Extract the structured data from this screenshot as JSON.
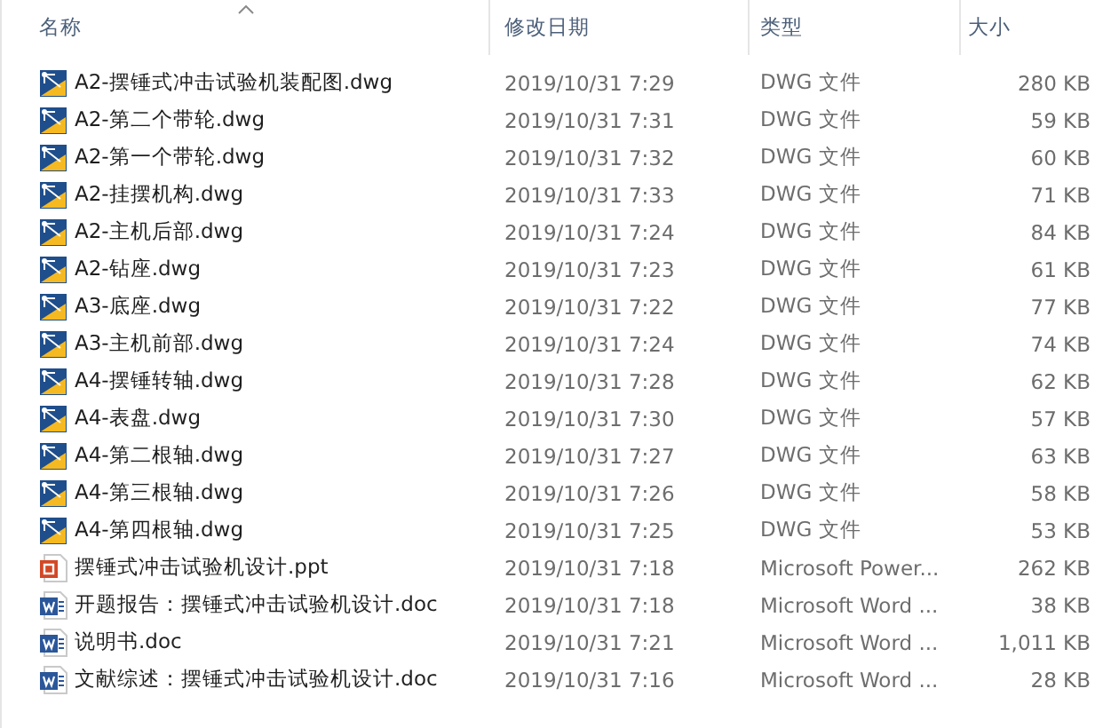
{
  "columns": [
    {
      "label": "名称",
      "sorted": true
    },
    {
      "label": "修改日期",
      "sorted": false
    },
    {
      "label": "类型",
      "sorted": false
    },
    {
      "label": "大小",
      "sorted": false
    }
  ],
  "files": [
    {
      "kind": "dwg",
      "name": "A2-摆锤式冲击试验机装配图.dwg",
      "date": "2019/10/31 7:29",
      "type": "DWG 文件",
      "size": "280 KB"
    },
    {
      "kind": "dwg",
      "name": "A2-第二个带轮.dwg",
      "date": "2019/10/31 7:31",
      "type": "DWG 文件",
      "size": "59 KB"
    },
    {
      "kind": "dwg",
      "name": "A2-第一个带轮.dwg",
      "date": "2019/10/31 7:32",
      "type": "DWG 文件",
      "size": "60 KB"
    },
    {
      "kind": "dwg",
      "name": "A2-挂摆机构.dwg",
      "date": "2019/10/31 7:33",
      "type": "DWG 文件",
      "size": "71 KB"
    },
    {
      "kind": "dwg",
      "name": "A2-主机后部.dwg",
      "date": "2019/10/31 7:24",
      "type": "DWG 文件",
      "size": "84 KB"
    },
    {
      "kind": "dwg",
      "name": "A2-钻座.dwg",
      "date": "2019/10/31 7:23",
      "type": "DWG 文件",
      "size": "61 KB"
    },
    {
      "kind": "dwg",
      "name": "A3-底座.dwg",
      "date": "2019/10/31 7:22",
      "type": "DWG 文件",
      "size": "77 KB"
    },
    {
      "kind": "dwg",
      "name": "A3-主机前部.dwg",
      "date": "2019/10/31 7:24",
      "type": "DWG 文件",
      "size": "74 KB"
    },
    {
      "kind": "dwg",
      "name": "A4-摆锤转轴.dwg",
      "date": "2019/10/31 7:28",
      "type": "DWG 文件",
      "size": "62 KB"
    },
    {
      "kind": "dwg",
      "name": "A4-表盘.dwg",
      "date": "2019/10/31 7:30",
      "type": "DWG 文件",
      "size": "57 KB"
    },
    {
      "kind": "dwg",
      "name": "A4-第二根轴.dwg",
      "date": "2019/10/31 7:27",
      "type": "DWG 文件",
      "size": "63 KB"
    },
    {
      "kind": "dwg",
      "name": "A4-第三根轴.dwg",
      "date": "2019/10/31 7:26",
      "type": "DWG 文件",
      "size": "58 KB"
    },
    {
      "kind": "dwg",
      "name": "A4-第四根轴.dwg",
      "date": "2019/10/31 7:25",
      "type": "DWG 文件",
      "size": "53 KB"
    },
    {
      "kind": "ppt",
      "name": "摆锤式冲击试验机设计.ppt",
      "date": "2019/10/31 7:18",
      "type": "Microsoft Power...",
      "size": "262 KB"
    },
    {
      "kind": "doc",
      "name": "开题报告：摆锤式冲击试验机设计.doc",
      "date": "2019/10/31 7:18",
      "type": "Microsoft Word ...",
      "size": "38 KB"
    },
    {
      "kind": "doc",
      "name": "说明书.doc",
      "date": "2019/10/31 7:21",
      "type": "Microsoft Word ...",
      "size": "1,011 KB"
    },
    {
      "kind": "doc",
      "name": "文献综述：摆锤式冲击试验机设计.doc",
      "date": "2019/10/31 7:16",
      "type": "Microsoft Word ...",
      "size": "28 KB"
    }
  ]
}
